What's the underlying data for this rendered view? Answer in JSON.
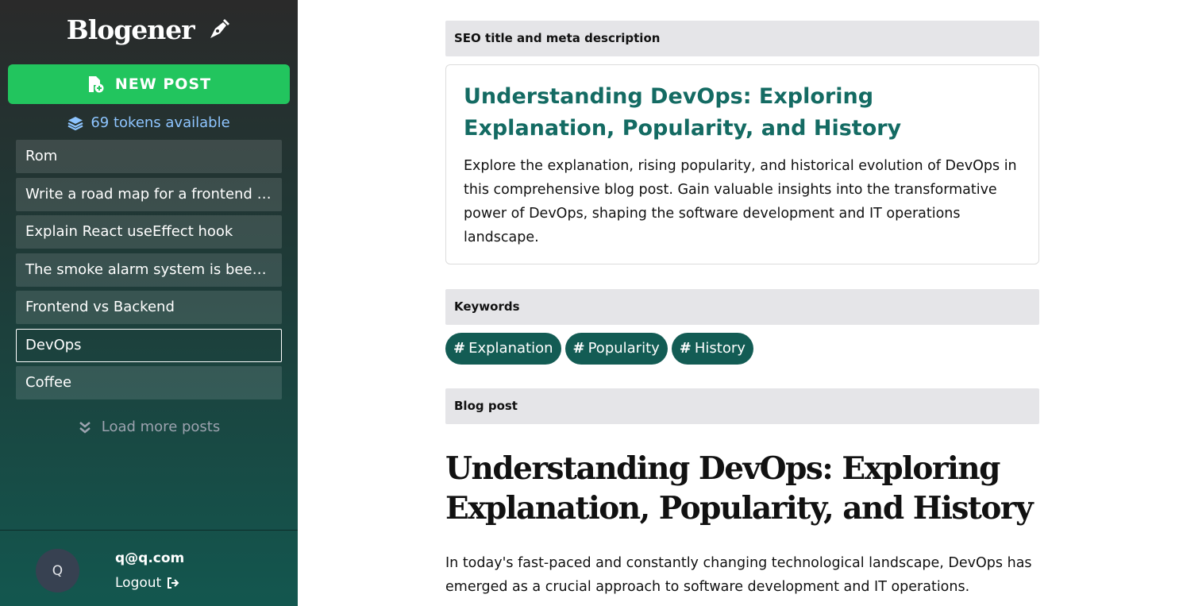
{
  "sidebar": {
    "brand": "Blogener",
    "new_post_label": "NEW POST",
    "tokens_text": "69 tokens available",
    "posts": [
      {
        "label": "Rom"
      },
      {
        "label": "Write a road map for a frontend developer"
      },
      {
        "label": "Explain React useEffect hook"
      },
      {
        "label": "The smoke alarm system is beeping"
      },
      {
        "label": "Frontend vs Backend"
      },
      {
        "label": "DevOps",
        "active": true
      },
      {
        "label": "Coffee"
      }
    ],
    "load_more_label": "Load more posts",
    "user": {
      "avatar_initial": "Q",
      "email": "q@q.com",
      "logout_label": "Logout"
    }
  },
  "main": {
    "seo_header": "SEO title and meta description",
    "seo_title": "Understanding DevOps: Exploring Explanation, Popularity, and History",
    "seo_description": "Explore the explanation, rising popularity, and historical evolution of DevOps in this comprehensive blog post. Gain valuable insights into the transformative power of DevOps, shaping the software development and IT operations landscape.",
    "keywords_header": "Keywords",
    "keywords": [
      "Explanation",
      "Popularity",
      "History"
    ],
    "blog_header": "Blog post",
    "blog_title": "Understanding DevOps: Exploring Explanation, Popularity, and History",
    "blog_intro": "In today's fast-paced and constantly changing technological landscape, DevOps has emerged as a crucial approach to software development and IT operations."
  },
  "colors": {
    "new_post_green": "#22c55e",
    "accent_teal": "#146b63",
    "keyword_pill": "#135c54",
    "tokens_blue": "#8ec5ff"
  },
  "icons": [
    "pen-nib-icon",
    "file-plus-icon",
    "layers-icon",
    "double-chevron-down-icon",
    "logout-icon",
    "hash-icon"
  ]
}
